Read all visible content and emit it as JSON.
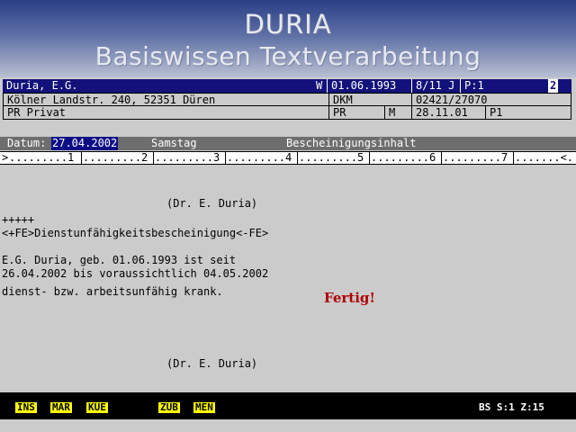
{
  "banner": {
    "title": "DURIA",
    "subtitle": "Basiswissen Textverarbeitung"
  },
  "header": {
    "row1": {
      "name": "Duria, E.G.",
      "flag": "W",
      "birthdate": "01.06.1993",
      "quarter": "8/11 J",
      "page": "P:1",
      "number": "2"
    },
    "row2": {
      "address": "Kölner Landstr. 240, 52351 Düren",
      "insurance": "DKM",
      "phone": "02421/27070"
    },
    "row3": {
      "type": "PR Privat",
      "code": "PR",
      "sex": "M",
      "date": "28.11.01",
      "p": "P1"
    }
  },
  "datum": {
    "label": "Datum:",
    "value": "27.04.2002",
    "weekday": "Samstag",
    "section": "Bescheinigungsinhalt"
  },
  "ruler": {
    "start": ">",
    "segments": [
      ".........1",
      ".........2",
      ".........3",
      ".........4",
      ".........5",
      ".........6",
      ".........7",
      ".......<."
    ]
  },
  "document": {
    "sender_top": "(Dr. E. Duria)",
    "marker": "+++++",
    "heading": "<+FE>Dienstunfähigkeitsbescheinigung<-FE>",
    "line1": " E.G. Duria, geb. 01.06.1993 ist seit",
    "line2": "26.04.2002 bis voraussichtlich 04.05.2002",
    "line3": "dienst- bzw. arbeitsunfähig krank.",
    "sender_bottom": "(Dr. E. Duria)",
    "stamp": "Fertig!"
  },
  "statusbar": {
    "keys": [
      "INS",
      "MAR",
      "KUE",
      "ZUB",
      "MEN"
    ],
    "right": "BS S:1 Z:15"
  }
}
